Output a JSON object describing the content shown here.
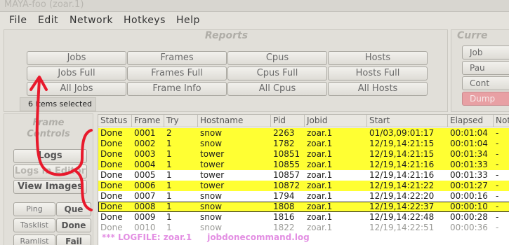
{
  "window": {
    "title": "MAYA-foo (zoar.1)"
  },
  "menubar": {
    "items": [
      "File",
      "Edit",
      "Network",
      "Hotkeys",
      "Help"
    ]
  },
  "reports": {
    "title": "Reports",
    "buttons": [
      [
        "Jobs",
        "Frames",
        "Cpus",
        "Hosts"
      ],
      [
        "Jobs Full",
        "Frames Full",
        "Cpus Full",
        "Hosts Full"
      ],
      [
        "All Jobs",
        "Frame Info",
        "All Cpus",
        "All Hosts"
      ]
    ]
  },
  "current": {
    "title": "Curre",
    "buttons": [
      "Job",
      "Pau",
      "Cont",
      "Dump"
    ]
  },
  "selection": {
    "label": "6 items selected"
  },
  "frame_controls": {
    "title": "Frame Controls",
    "buttons": [
      "Logs",
      "Logs in Editor",
      "View Images"
    ],
    "small_buttons": [
      {
        "left": "Ping",
        "right": "Que"
      },
      {
        "left": "Tasklist",
        "right": "Done"
      },
      {
        "left": "Ramlist",
        "right": "Fail"
      }
    ]
  },
  "table": {
    "columns": [
      "Status",
      "Frame",
      "Try",
      "Hostname",
      "Pid",
      "Jobid",
      "Start",
      "Elapsed",
      "Notes"
    ],
    "rows": [
      [
        "Done",
        "0001",
        "2",
        "snow",
        "2263",
        "zoar.1",
        "01/03,09:01:17",
        "00:01:04",
        "-"
      ],
      [
        "Done",
        "0002",
        "1",
        "snow",
        "1782",
        "zoar.1",
        "12/19,14:21:15",
        "00:01:04",
        "-"
      ],
      [
        "Done",
        "0003",
        "1",
        "tower",
        "10851",
        "zoar.1",
        "12/19,14:21:15",
        "00:01:34",
        "-"
      ],
      [
        "Done",
        "0004",
        "1",
        "tower",
        "10855",
        "zoar.1",
        "12/19,14:21:16",
        "00:01:33",
        "-"
      ],
      [
        "Done",
        "0005",
        "1",
        "tower",
        "10857",
        "zoar.1",
        "12/19,14:21:16",
        "00:01:33",
        "-"
      ],
      [
        "Done",
        "0006",
        "1",
        "tower",
        "10872",
        "zoar.1",
        "12/19,14:21:22",
        "00:01:27",
        "-"
      ],
      [
        "Done",
        "0007",
        "1",
        "snow",
        "1794",
        "zoar.1",
        "12/19,14:22:20",
        "00:00:16",
        "-"
      ],
      [
        "Done",
        "0008",
        "1",
        "snow",
        "1808",
        "zoar.1",
        "12/19,14:22:37",
        "00:00:10",
        "-"
      ],
      [
        "Done",
        "0009",
        "1",
        "snow",
        "1816",
        "zoar.1",
        "12/19,14:22:48",
        "00:00:28",
        "-"
      ],
      [
        "Done",
        "0010",
        "1",
        "snow",
        "1822",
        "zoar.1",
        "12/19,14:22:51",
        "00:00:36",
        "-"
      ]
    ],
    "row_state": [
      "hl",
      "hl",
      "hl",
      "hl",
      "plain",
      "hl",
      "plain",
      "sel",
      "plain",
      "dim"
    ],
    "log_prefix": "*** LOGFILE: zoar.1",
    "log_file": "jobdonecommand.log"
  },
  "colors": {
    "highlight": "#ffff33",
    "annotation": "#e8192c",
    "deep_button": "#e8a0a4",
    "log_text": "#e38fe3"
  }
}
